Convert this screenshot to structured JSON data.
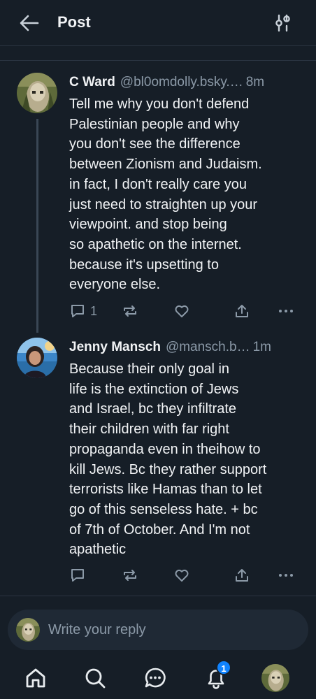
{
  "header": {
    "title": "Post",
    "back_icon": "arrow-left-icon",
    "filter_icon": "sliders-icon"
  },
  "posts": [
    {
      "name": "C Ward",
      "handle": "@bl0omdolly.bsky.…",
      "time": "8m",
      "text": "Tell me why you don't defend\nPalestinian people and why\nyou don't see the difference\nbetween Zionism and Judaism.\nin fact, I don't really care you\njust need to straighten up your\nviewpoint. and stop being\nso apathetic on the internet.\nbecause it's upsetting to\neveryone else.",
      "reply_count": "1",
      "repost_count": "",
      "like_count": ""
    },
    {
      "name": "Jenny Mansch",
      "handle": "@mansch.b…",
      "time": "1m",
      "text": "Because their only goal in\nlife is the extinction of Jews\nand Israel, bc they infiltrate\ntheir children with far right\npropaganda even in theihow to\nkill Jews. Bc they rather support\nterrorists like Hamas than to let\ngo of this senseless hate. + bc\nof 7th of October. And I'm not\napathetic",
      "reply_count": "",
      "repost_count": "",
      "like_count": ""
    }
  ],
  "composer": {
    "placeholder": "Write your reply"
  },
  "bottom_nav": {
    "items": [
      "home-icon",
      "search-icon",
      "chat-icon",
      "bell-icon",
      "profile-avatar"
    ],
    "notification_badge": "1"
  },
  "colors": {
    "background": "#161e27",
    "divider": "#2a3441",
    "muted_text": "#8c9aa8",
    "accent": "#1083fe"
  }
}
